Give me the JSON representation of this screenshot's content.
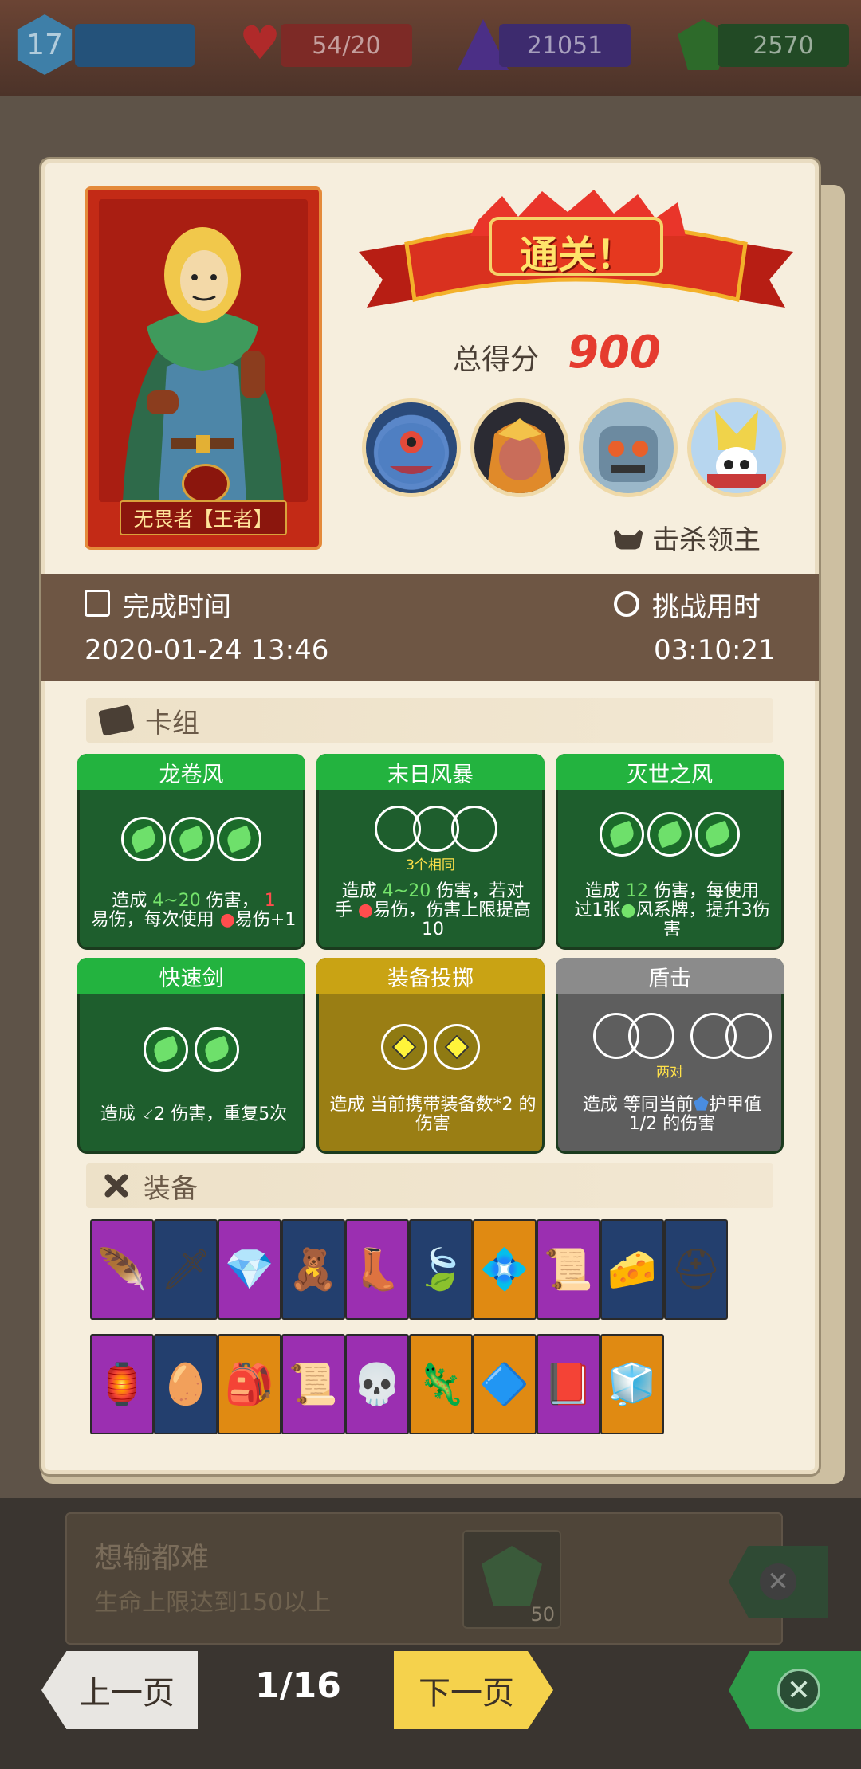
{
  "status": {
    "level": "17",
    "hp": "54/20",
    "crystals": "21051",
    "gems": "2570"
  },
  "hero": {
    "name": "无畏者【王者】"
  },
  "result": {
    "banner": "通关！",
    "score_label": "总得分",
    "score": "900",
    "kill_label": "击杀领主"
  },
  "time": {
    "finish_label": "完成时间",
    "finish_value": "2020-01-24 13:46",
    "duration_label": "挑战用时",
    "duration_value": "03:10:21"
  },
  "deck": {
    "title": "卡组",
    "cards": [
      {
        "name": "龙卷风",
        "style": "green",
        "slots": "3-leaf",
        "note": "",
        "desc_pre": "造成",
        "desc_hl": "4~20",
        "desc_post": "伤害，",
        "desc_hl2": "1",
        "desc_line2": "易伤，每次使用",
        "desc_line2b": "易伤+1"
      },
      {
        "name": "末日风暴",
        "style": "green",
        "slots": "3-open",
        "note": "3个相同",
        "desc_pre": "造成",
        "desc_hl": "4~20",
        "desc_post": "伤害，若对",
        "desc_line2": "手",
        "desc_line2b": "易伤，伤害上限提高",
        "desc_line3": "10"
      },
      {
        "name": "灭世之风",
        "style": "green",
        "slots": "3-leaf",
        "note": "",
        "desc_pre": "造成",
        "desc_hl": "12",
        "desc_post": "伤害，每使用",
        "desc_line2": "过1张",
        "desc_line2b": "风系牌，提升3伤",
        "desc_line3": "害"
      },
      {
        "name": "快速剑",
        "style": "green",
        "slots": "2-leaf",
        "note": "",
        "desc_pre": "造成",
        "desc_hl": "2",
        "desc_post": "伤害，重复5次"
      },
      {
        "name": "装备投掷",
        "style": "gold",
        "slots": "2-diamond",
        "note": "",
        "desc_pre": "造成 当前携带装备数*2 的",
        "desc_line2": "伤害"
      },
      {
        "name": "盾击",
        "style": "grey",
        "slots": "2-pairs",
        "note": "两对",
        "desc_pre": "造成 等同当前",
        "desc_post": "护甲值",
        "desc_line2": "1/2 的伤害"
      }
    ]
  },
  "equipment": {
    "title": "装备",
    "row1": [
      {
        "bg": "#9b2fb1",
        "icon": "feather-icon",
        "glyph": "🪶"
      },
      {
        "bg": "#233f6e",
        "icon": "claw-icon",
        "glyph": "🗡"
      },
      {
        "bg": "#9b2fb1",
        "icon": "ruby-amulet-icon",
        "glyph": "💎"
      },
      {
        "bg": "#233f6e",
        "icon": "voodoo-doll-icon",
        "glyph": "🧸"
      },
      {
        "bg": "#9b2fb1",
        "icon": "boot-icon",
        "glyph": "👢"
      },
      {
        "bg": "#233f6e",
        "icon": "leaf-icon",
        "glyph": "🍃"
      },
      {
        "bg": "#e08a12",
        "icon": "skull-gem-icon",
        "glyph": "💠"
      },
      {
        "bg": "#9b2fb1",
        "icon": "scroll-icon",
        "glyph": "📜"
      },
      {
        "bg": "#233f6e",
        "icon": "mossy-cheese-icon",
        "glyph": "🧀"
      },
      {
        "bg": "#233f6e",
        "icon": "golden-helmet-icon",
        "glyph": "⛑"
      }
    ],
    "row2": [
      {
        "bg": "#9b2fb1",
        "icon": "lantern-icon",
        "glyph": "🏮"
      },
      {
        "bg": "#233f6e",
        "icon": "green-egg-icon",
        "glyph": "🥚"
      },
      {
        "bg": "#e08a12",
        "icon": "backpack-icon",
        "glyph": "🎒"
      },
      {
        "bg": "#9b2fb1",
        "icon": "fire-scroll-icon",
        "glyph": "📜"
      },
      {
        "bg": "#9b2fb1",
        "icon": "skull-mask-icon",
        "glyph": "💀"
      },
      {
        "bg": "#e08a12",
        "icon": "lizard-icon",
        "glyph": "🦎"
      },
      {
        "bg": "#e08a12",
        "icon": "rainbow-gem-icon",
        "glyph": "🔷"
      },
      {
        "bg": "#9b2fb1",
        "icon": "poison-book-icon",
        "glyph": "📕"
      },
      {
        "bg": "#e08a12",
        "icon": "ice-crystal-icon",
        "glyph": "🧊"
      }
    ]
  },
  "achievement": {
    "title": "想输都难",
    "desc": "生命上限达到150以上",
    "reward": "50"
  },
  "nav": {
    "prev": "上一页",
    "page": "1/16",
    "next": "下一页"
  }
}
